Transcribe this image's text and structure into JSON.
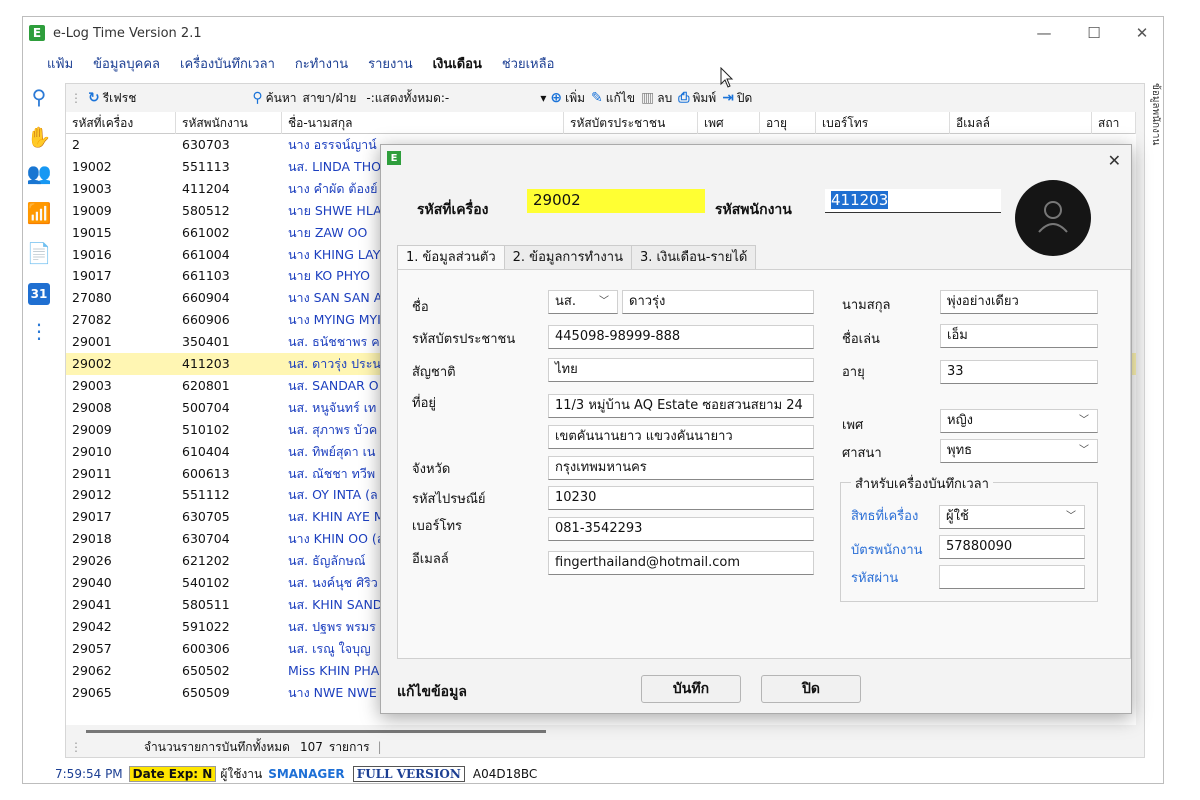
{
  "window": {
    "title": "e-Log Time Version 2.1",
    "app_icon": "E"
  },
  "menu": [
    "แฟ้ม",
    "ข้อมูลบุคคล",
    "เครื่องบันทึกเวลา",
    "กะทำงาน",
    "รายงาน",
    "เงินเดือน",
    "ช่วยเหลือ"
  ],
  "toolbar": {
    "refresh": "รีเฟรช",
    "search": "ค้นหา",
    "branch_label": "สาขา/ฝ่าย",
    "branch_value": "-:แสดงทั้งหมด:-",
    "add": "เพิ่ม",
    "edit": "แก้ไข",
    "delete": "ลบ",
    "print": "พิมพ์",
    "close": "ปิด"
  },
  "grid": {
    "headers": [
      "รหัสที่เครื่อง",
      "รหัสพนักงาน",
      "ชื่อ-นามสกุล",
      "รหัสบัตรประชาชน",
      "เพศ",
      "อายุ",
      "เบอร์โทร",
      "อีเมลล์",
      "สถา"
    ],
    "rows": [
      [
        "2",
        "630703",
        "นาง อรรจน์ญาน์"
      ],
      [
        "19002",
        "551113",
        "นส. LINDA THO"
      ],
      [
        "19003",
        "411204",
        "นาง คำผัด ต้องย์"
      ],
      [
        "19009",
        "580512",
        "นาย SHWE HLA"
      ],
      [
        "19015",
        "661002",
        "นาย ZAW OO"
      ],
      [
        "19016",
        "661004",
        "นาง KHING LAY"
      ],
      [
        "19017",
        "661103",
        "นาย KO PHYO"
      ],
      [
        "27080",
        "660904",
        "นาง SAN SAN A"
      ],
      [
        "27082",
        "660906",
        "นาง MYING MYI"
      ],
      [
        "29001",
        "350401",
        "นส. ธนัชชาพร ค"
      ],
      [
        "29002",
        "411203",
        "นส. ดาวรุ่ง ประน"
      ],
      [
        "29003",
        "620801",
        "นส. SANDAR O"
      ],
      [
        "29008",
        "500704",
        "นส. หนูจันทร์ เท"
      ],
      [
        "29009",
        "510102",
        "นส. สุภาพร บัวค"
      ],
      [
        "29010",
        "610404",
        "นส. ทิพย์สุดา เน"
      ],
      [
        "29011",
        "600613",
        "นส. ณัชชา ทวีพ"
      ],
      [
        "29012",
        "551112",
        "นส. OY INTA (ล"
      ],
      [
        "29017",
        "630705",
        "นส. KHIN AYE M"
      ],
      [
        "29018",
        "630704",
        "นาง KHIN OO (ล"
      ],
      [
        "29026",
        "621202",
        "นส. ธัญลักษณ์"
      ],
      [
        "29040",
        "540102",
        "นส. นงค์นุช ศิริว"
      ],
      [
        "29041",
        "580511",
        "นส. KHIN SAND"
      ],
      [
        "29042",
        "591022",
        "นส. ปฐพร พรมร"
      ],
      [
        "29057",
        "600306",
        "นส. เรณู ใจบุญ"
      ],
      [
        "29062",
        "650502",
        "Miss KHIN PHA"
      ],
      [
        "29065",
        "650509",
        "นาง NWE NWE"
      ]
    ],
    "selected_row": 10
  },
  "footer": {
    "count_label": "จำนวนรายการบันทึกทั้งหมด",
    "count": "107",
    "unit": "รายการ"
  },
  "status": {
    "time": "7:59:54 PM",
    "date_exp": "Date Exp: N",
    "user_label": "ผู้ใช้งาน",
    "user": "SMANAGER",
    "version": "FULL VERSION",
    "code": "A04D18BC"
  },
  "vertical_tab": "ข้อมูลพนักงาน",
  "dialog": {
    "icon": "E",
    "machine_id_label": "รหัสที่เครื่อง",
    "machine_id": "29002",
    "emp_id_label": "รหัสพนักงาน",
    "emp_id": "411203",
    "tabs": [
      "1. ข้อมูลส่วนตัว",
      "2. ข้อมูลการทำงาน",
      "3. เงินเดือน-รายได้"
    ],
    "fields": {
      "name_label": "ชื่อ",
      "prefix": "นส.",
      "first_name": "ดาวรุ่ง",
      "id_card_label": "รหัสบัตรประชาชน",
      "id_card": "445098-98999-888",
      "nationality_label": "สัญชาติ",
      "nationality": "ไทย",
      "address_label": "ที่อยู่",
      "address1": "11/3 หมู่บ้าน AQ Estate ซอยสวนสยาม 24",
      "address2": "เขตคันนานยาว แขวงคันนายาว",
      "province_label": "จังหวัด",
      "province": "กรุงเทพมหานคร",
      "postcode_label": "รหัสไปรษณีย์",
      "postcode": "10230",
      "phone_label": "เบอร์โทร",
      "phone": "081-3542293",
      "email_label": "อีเมลล์",
      "email": "fingerthailand@hotmail.com",
      "surname_label": "นามสกุล",
      "surname": "พุ่งอย่างเดียว",
      "nickname_label": "ชื่อเล่น",
      "nickname": "เอ็ม",
      "age_label": "อายุ",
      "age": "33",
      "gender_label": "เพศ",
      "gender": "หญิง",
      "religion_label": "ศาสนา",
      "religion": "พุทธ"
    },
    "device_group": {
      "title": "สำหรับเครื่องบันทึกเวลา",
      "rights_label": "สิทธที่เครื่อง",
      "rights": "ผู้ใช้",
      "card_label": "บัตรพนักงาน",
      "card": "57880090",
      "password_label": "รหัสผ่าน",
      "password": ""
    },
    "mode": "แก้ไขข้อมูล",
    "save": "บันทึก",
    "close": "ปิด"
  }
}
